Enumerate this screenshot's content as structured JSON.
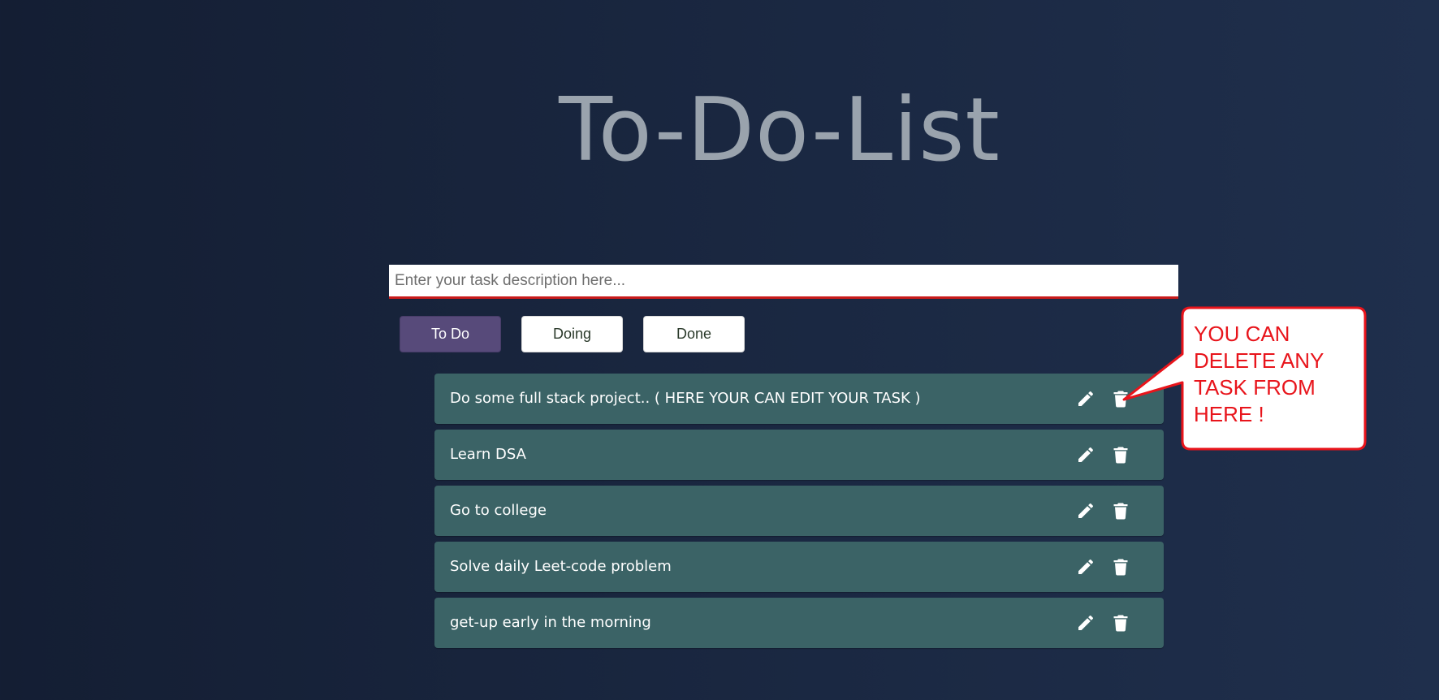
{
  "title": "To-Do-List",
  "input": {
    "placeholder": "Enter your task description here...",
    "value": ""
  },
  "filters": [
    {
      "label": "To Do",
      "active": true
    },
    {
      "label": "Doing",
      "active": false
    },
    {
      "label": "Done",
      "active": false
    }
  ],
  "tasks": [
    {
      "text": "Do some full stack project.. ( HERE YOUR CAN EDIT YOUR TASK )"
    },
    {
      "text": "Learn DSA"
    },
    {
      "text": "Go to college"
    },
    {
      "text": "Solve daily Leet-code problem"
    },
    {
      "text": "get-up early in the morning"
    }
  ],
  "task_icons": {
    "edit": "pencil-icon",
    "delete": "trash-icon"
  },
  "annotation": {
    "text": "YOU CAN DELETE ANY TASK FROM HERE !",
    "color": "#e8141b"
  },
  "colors": {
    "accent": "#574a7a",
    "task_background": "#3b6366",
    "input_underline": "#c91b1b",
    "title": "#9aa3ad"
  }
}
